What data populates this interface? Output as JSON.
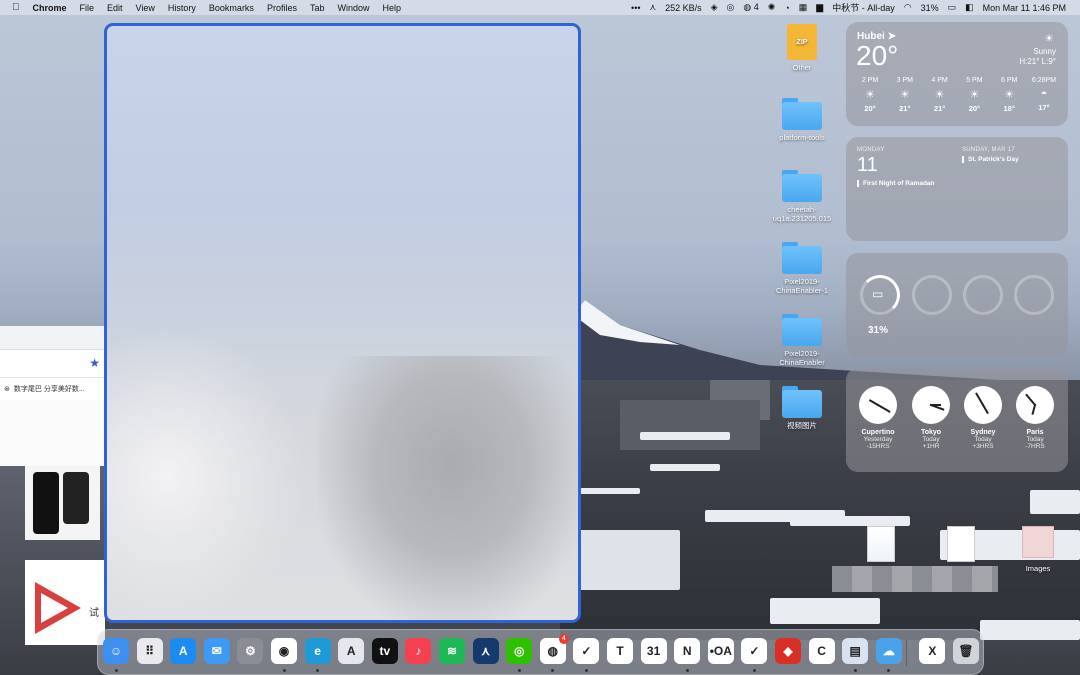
{
  "menubar": {
    "apple": "",
    "app_name": "Chrome",
    "menus": [
      "File",
      "Edit",
      "View",
      "History",
      "Bookmarks",
      "Profiles",
      "Tab",
      "Window",
      "Help"
    ],
    "status": {
      "ellipsis": "•••",
      "network": "252 KB/s",
      "qq_count": "4",
      "calendar_event": "中秋节 - All-day",
      "battery": "31%",
      "datetime": "Mon Mar 11  1:46 PM"
    }
  },
  "browser_partial": {
    "bookmark_text": "数字尾巴 分享美好数..."
  },
  "thumb2_text": "试",
  "desktop": {
    "icons": [
      {
        "label": "Other",
        "type": "zip"
      },
      {
        "label": "platform-tools",
        "type": "folder"
      },
      {
        "label": "cheetah-uq1a.231205.015",
        "type": "folder"
      },
      {
        "label": "Pixel2019-ChinaEnabler-1",
        "type": "folder"
      },
      {
        "label": "Pixel2019-ChinaEnabler",
        "type": "folder"
      },
      {
        "label": "视频图片",
        "type": "folder"
      },
      {
        "label": "Images",
        "type": "image"
      }
    ],
    "zip_badge": "ZIP"
  },
  "weather": {
    "city": "Hubei",
    "temperature": "20°",
    "condition": "Sunny",
    "high_low": "H:21° L:9°",
    "hours": [
      {
        "time": "2 PM",
        "temp": "20°",
        "icon": "sun-icon"
      },
      {
        "time": "3 PM",
        "temp": "21°",
        "icon": "sun-icon"
      },
      {
        "time": "4 PM",
        "temp": "21°",
        "icon": "sun-icon"
      },
      {
        "time": "5 PM",
        "temp": "20°",
        "icon": "sun-icon"
      },
      {
        "time": "6 PM",
        "temp": "18°",
        "icon": "sun-icon"
      },
      {
        "time": "6:28PM",
        "temp": "17°",
        "icon": "sunset-icon"
      }
    ]
  },
  "calendar": {
    "today_day": "MONDAY",
    "today_num": "11",
    "today_event": "First Night of Ramadan",
    "next_day": "SUNDAY, MAR 17",
    "next_event": "St. Patrick's Day"
  },
  "battery_widget": {
    "percent": "31%",
    "level": 0.31
  },
  "clocks": [
    {
      "city": "Cupertino",
      "day": "Yesterday",
      "offset": "-15HRS"
    },
    {
      "city": "Tokyo",
      "day": "Today",
      "offset": "+1HR"
    },
    {
      "city": "Sydney",
      "day": "Today",
      "offset": "+3HRS"
    },
    {
      "city": "Paris",
      "day": "Today",
      "offset": "-7HRS"
    }
  ],
  "dock": {
    "apps": [
      {
        "name": "finder",
        "color": "#3d8ff0",
        "glyph": "☺",
        "running": true
      },
      {
        "name": "launchpad",
        "color": "#e9e9ee",
        "glyph": "⠿",
        "running": false
      },
      {
        "name": "app-store",
        "color": "#1c8cf3",
        "glyph": "A",
        "running": false
      },
      {
        "name": "mail",
        "color": "#3f9af5",
        "glyph": "✉",
        "running": false
      },
      {
        "name": "system-settings",
        "color": "#8a8d93",
        "glyph": "⚙",
        "running": false
      },
      {
        "name": "chrome",
        "color": "#ffffff",
        "glyph": "◉",
        "running": true
      },
      {
        "name": "edge",
        "color": "#1e9ad6",
        "glyph": "e",
        "running": true
      },
      {
        "name": "affinity",
        "color": "#e6e6ee",
        "glyph": "A",
        "running": false
      },
      {
        "name": "apple-tv",
        "color": "#111111",
        "glyph": "tv",
        "running": false
      },
      {
        "name": "music",
        "color": "#f4404f",
        "glyph": "♪",
        "running": false
      },
      {
        "name": "spotify",
        "color": "#1db954",
        "glyph": "≋",
        "running": false
      },
      {
        "name": "feishu",
        "color": "#163a6e",
        "glyph": "⋏",
        "running": false
      },
      {
        "name": "wechat",
        "color": "#2dc100",
        "glyph": "◎",
        "running": true
      },
      {
        "name": "qq",
        "color": "#ffffff",
        "glyph": "◍",
        "running": true,
        "badge": "4"
      },
      {
        "name": "spark-mail",
        "color": "#ffffff",
        "glyph": "✓",
        "running": true
      },
      {
        "name": "typora",
        "color": "#ffffff",
        "glyph": "T",
        "running": false
      },
      {
        "name": "calendar",
        "color": "#ffffff",
        "glyph": "31",
        "running": false
      },
      {
        "name": "notion",
        "color": "#ffffff",
        "glyph": "N",
        "running": true
      },
      {
        "name": "bear",
        "color": "#ffffff",
        "glyph": "•OA",
        "running": false
      },
      {
        "name": "ticktick",
        "color": "#ffffff",
        "glyph": "✓",
        "running": true
      },
      {
        "name": "red-app",
        "color": "#d93025",
        "glyph": "◆",
        "running": false
      },
      {
        "name": "cleanmymac",
        "color": "#ffffff",
        "glyph": "C",
        "running": false
      },
      {
        "name": "preview",
        "color": "#d8e3ef",
        "glyph": "▤",
        "running": true
      },
      {
        "name": "weather",
        "color": "#4aa3ea",
        "glyph": "☁",
        "running": true
      },
      {
        "name": "excel",
        "color": "#ffffff",
        "glyph": "X",
        "running": false
      },
      {
        "name": "trash",
        "color": "#d0d3d8",
        "glyph": "🗑",
        "running": false
      }
    ]
  }
}
